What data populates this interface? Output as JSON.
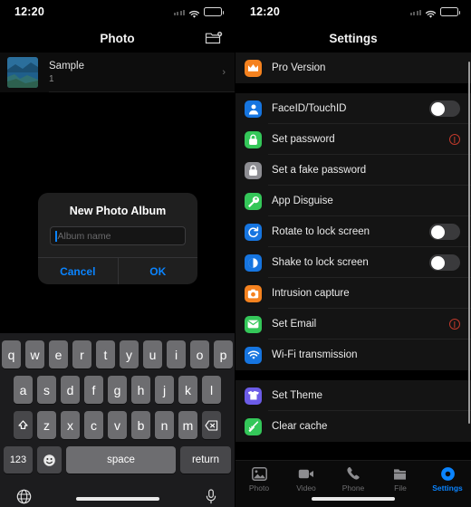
{
  "left": {
    "status": {
      "time": "12:20"
    },
    "nav": {
      "title": "Photo",
      "action_icon": "new-folder-icon"
    },
    "album": {
      "title": "Sample",
      "count": "1",
      "chevron": "›"
    },
    "dialog": {
      "title": "New Photo Album",
      "input_placeholder": "Album name",
      "input_value": "",
      "cancel_label": "Cancel",
      "ok_label": "OK"
    },
    "keyboard": {
      "row1": [
        "q",
        "w",
        "e",
        "r",
        "t",
        "y",
        "u",
        "i",
        "o",
        "p"
      ],
      "row2": [
        "a",
        "s",
        "d",
        "f",
        "g",
        "h",
        "j",
        "k",
        "l"
      ],
      "row3": [
        "z",
        "x",
        "c",
        "v",
        "b",
        "n",
        "m"
      ],
      "shift_icon": "shift-icon",
      "backspace_icon": "backspace-icon",
      "numbers_label": "123",
      "emoji_icon": "emoji-icon",
      "space_label": "space",
      "return_label": "return",
      "globe_icon": "globe-icon",
      "mic_icon": "microphone-icon"
    }
  },
  "right": {
    "status": {
      "time": "12:20"
    },
    "nav": {
      "title": "Settings"
    },
    "groups": [
      {
        "rows": [
          {
            "label": "Pro Version",
            "icon": "crown-icon",
            "icon_color": "#F5821F",
            "accessory": "none"
          }
        ]
      },
      {
        "rows": [
          {
            "label": "FaceID/TouchID",
            "icon": "faceid-person-icon",
            "icon_color": "#1675E0",
            "accessory": "toggle",
            "toggle_on": false
          },
          {
            "label": "Set password",
            "icon": "lock-icon",
            "icon_color": "#34C759",
            "accessory": "warning"
          },
          {
            "label": "Set a fake password",
            "icon": "lock-icon",
            "icon_color": "#8E8E93",
            "accessory": "none"
          },
          {
            "label": "App Disguise",
            "icon": "wrench-icon",
            "icon_color": "#34C759",
            "accessory": "none"
          },
          {
            "label": "Rotate to lock screen",
            "icon": "rotate-icon",
            "icon_color": "#1675E0",
            "accessory": "toggle",
            "toggle_on": false
          },
          {
            "label": "Shake to lock screen",
            "icon": "shake-icon",
            "icon_color": "#1675E0",
            "accessory": "toggle",
            "toggle_on": false
          },
          {
            "label": "Intrusion capture",
            "icon": "camera-icon",
            "icon_color": "#F5821F",
            "accessory": "none"
          },
          {
            "label": "Set Email",
            "icon": "envelope-icon",
            "icon_color": "#34C759",
            "accessory": "warning"
          },
          {
            "label": "Wi-Fi transmission",
            "icon": "wifi-icon",
            "icon_color": "#1675E0",
            "accessory": "none"
          }
        ]
      },
      {
        "rows": [
          {
            "label": "Set Theme",
            "icon": "tshirt-icon",
            "icon_color": "#6C5CE7",
            "accessory": "none"
          },
          {
            "label": "Clear cache",
            "icon": "broom-icon",
            "icon_color": "#34C759",
            "accessory": "none"
          }
        ]
      }
    ],
    "tabs": [
      {
        "label": "Photo",
        "icon": "photo-icon",
        "active": false
      },
      {
        "label": "Video",
        "icon": "video-icon",
        "active": false
      },
      {
        "label": "Phone",
        "icon": "phone-icon",
        "active": false
      },
      {
        "label": "File",
        "icon": "file-icon",
        "active": false
      },
      {
        "label": "Settings",
        "icon": "settings-icon",
        "active": true
      }
    ]
  },
  "colors": {
    "accent_blue": "#0A84FF",
    "battery_yellow": "#F3C32C",
    "warning_red": "#C0392B",
    "card_bg": "#141414"
  }
}
